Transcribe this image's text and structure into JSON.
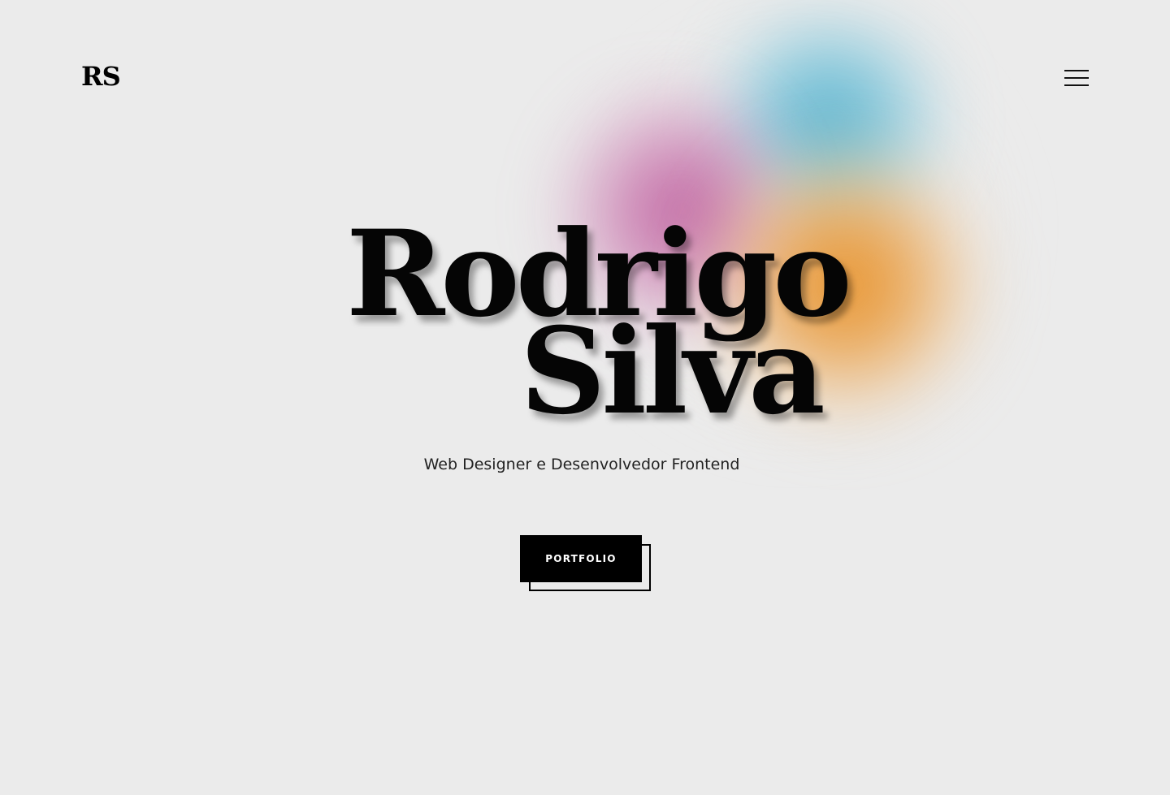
{
  "header": {
    "logo_text": "RS",
    "menu_icon": "hamburger-menu-icon"
  },
  "hero": {
    "first_name": "Rodrigo",
    "last_name": "Silva",
    "subtitle": "Web Designer e Desenvolvedor Frontend",
    "cta_label": "PORTFOLIO"
  },
  "colors": {
    "background": "#ebebeb",
    "text": "#050505",
    "gradient_blue": "#46aac8",
    "gradient_magenta": "#b95096",
    "gradient_orange": "#e68c1e",
    "button_bg": "#000000",
    "button_text": "#ffffff"
  }
}
